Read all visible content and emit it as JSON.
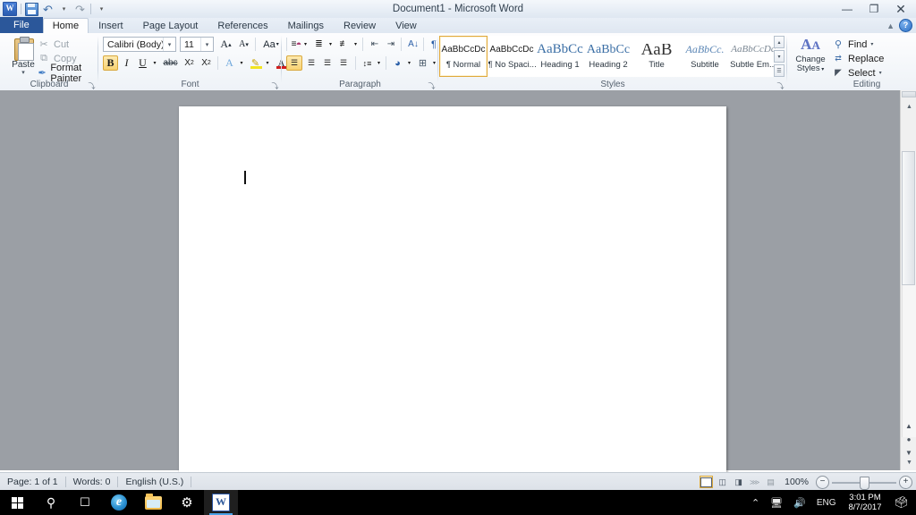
{
  "window": {
    "title": "Document1 - Microsoft Word",
    "minimize_label": "—",
    "restore_label": "❐",
    "close_label": "✕",
    "help_label": "?",
    "collapse_ribbon_label": "▲"
  },
  "quick_access": {
    "logo_label": "W",
    "items": [
      {
        "name": "save-button",
        "label": "💾"
      },
      {
        "name": "undo-button",
        "label": "↶"
      },
      {
        "name": "redo-button",
        "label": "↷"
      },
      {
        "name": "customize-qat-button",
        "label": "▾"
      }
    ]
  },
  "tabs": [
    {
      "id": "file",
      "label": "File"
    },
    {
      "id": "home",
      "label": "Home"
    },
    {
      "id": "insert",
      "label": "Insert"
    },
    {
      "id": "page-layout",
      "label": "Page Layout"
    },
    {
      "id": "references",
      "label": "References"
    },
    {
      "id": "mailings",
      "label": "Mailings"
    },
    {
      "id": "review",
      "label": "Review"
    },
    {
      "id": "view",
      "label": "View"
    }
  ],
  "active_tab": "Home",
  "ribbon": {
    "clipboard": {
      "title": "Clipboard",
      "paste_label": "Paste",
      "paste_caret": "▾",
      "cut_label": "Cut",
      "copy_label": "Copy",
      "format_painter_label": "Format Painter",
      "cut_icon": "✂",
      "copy_icon": "⧉",
      "format_painter_icon": "🖌",
      "dialog_launcher": "⤵"
    },
    "font": {
      "title": "Font",
      "font_name": "Calibri (Body)",
      "font_size": "11",
      "grow_font": "A▴",
      "shrink_font": "A▾",
      "change_case": "Aa",
      "clear_formatting": "⍉",
      "bold": "B",
      "italic": "I",
      "underline": "U",
      "strikethrough": "abc",
      "subscript": "X₂",
      "superscript": "X²",
      "text_effects": "A",
      "highlight_color": "ab",
      "font_color": "A",
      "dropdown_caret": "▾",
      "dialog_launcher": "⤵"
    },
    "paragraph": {
      "title": "Paragraph",
      "bullets": "☰",
      "numbering": "☷",
      "multilevel_list": "☲",
      "decrease_indent": "⬅",
      "increase_indent": "➡",
      "sort": "↓",
      "show_marks": "¶",
      "align_left": "☰",
      "align_center": "☰",
      "align_right": "☰",
      "justify": "☰",
      "line_spacing": "↕",
      "shading": "▣",
      "borders": "⊞",
      "dropdown_caret": "▾",
      "dialog_launcher": "⤵"
    },
    "styles": {
      "title": "Styles",
      "items": [
        {
          "preview": "AaBbCcDc",
          "name": "¶ Normal",
          "selected": true,
          "style": "normal"
        },
        {
          "preview": "AaBbCcDc",
          "name": "¶ No Spaci...",
          "selected": false,
          "style": "normal"
        },
        {
          "preview": "AaBbCc",
          "name": "Heading 1",
          "selected": false,
          "style": "h1"
        },
        {
          "preview": "AaBbCc",
          "name": "Heading 2",
          "selected": false,
          "style": "h2"
        },
        {
          "preview": "AaB",
          "name": "Title",
          "selected": false,
          "style": "title"
        },
        {
          "preview": "AaBbCc.",
          "name": "Subtitle",
          "selected": false,
          "style": "subtitle"
        },
        {
          "preview": "AaBbCcDc",
          "name": "Subtle Em...",
          "selected": false,
          "style": "subtle"
        }
      ],
      "scroll_up": "▴",
      "scroll_down": "▾",
      "more": "☰",
      "dialog_launcher": "⤵"
    },
    "editing": {
      "title": "Editing",
      "change_styles_label": "Change\nStyles",
      "change_styles_line1": "Change",
      "change_styles_line2": "Styles",
      "change_styles_caret": "▾",
      "find_label": "Find",
      "replace_label": "Replace",
      "select_label": "Select",
      "find_icon": "🔍",
      "replace_icon": "ab",
      "select_icon": "↖",
      "dropdown_caret": "▾"
    }
  },
  "document": {
    "caret_visible": true
  },
  "scrollbar": {
    "up_arrow": "▴",
    "down_arrow": "▾",
    "prev_page": "▴",
    "select_browse_object": "○",
    "next_page": "▾"
  },
  "status_bar": {
    "page": "Page: 1 of 1",
    "words": "Words: 0",
    "language": "English (U.S.)",
    "zoom_level": "100%",
    "zoom_out": "−",
    "zoom_in": "+",
    "views": [
      {
        "name": "print-layout",
        "active": true
      },
      {
        "name": "full-screen-reading",
        "active": false
      },
      {
        "name": "web-layout",
        "active": false
      },
      {
        "name": "outline",
        "active": false
      },
      {
        "name": "draft",
        "active": false
      }
    ]
  },
  "taskbar": {
    "start_label": "Start",
    "search_icon": "⌕",
    "taskview_icon": "▭",
    "ie_label": "e",
    "explorer_label": "Files",
    "settings_icon": "⚙",
    "word_label": "W",
    "tray": {
      "show_hidden": "∧",
      "network_icon": "🖧",
      "volume_icon": "🔊",
      "language": "ENG",
      "time": "3:01 PM",
      "date": "8/7/2017",
      "action_center": "▢"
    }
  },
  "colors": {
    "file_tab_blue": "#2b579a",
    "selected_style_border": "#e0a93c",
    "taskbar_black": "#000000",
    "doc_background": "#9b9fa5"
  }
}
